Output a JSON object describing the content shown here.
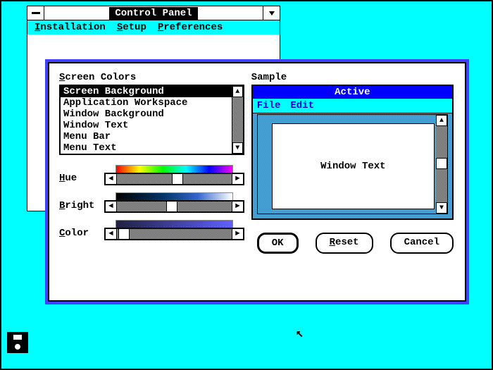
{
  "cp": {
    "title": "Control Panel",
    "menus": {
      "installation": "Installation",
      "setup": "Setup",
      "preferences": "Preferences"
    }
  },
  "dlg": {
    "section_left": "Screen Colors",
    "section_right": "Sample",
    "list": [
      "Screen Background",
      "Application Workspace",
      "Window Background",
      "Window Text",
      "Menu Bar",
      "Menu Text"
    ],
    "sliders": {
      "hue": "Hue",
      "bright": "Bright",
      "color": "Color"
    },
    "sample": {
      "title": "Active",
      "menu_file": "File",
      "menu_edit": "Edit",
      "window_text": "Window Text"
    },
    "buttons": {
      "ok": "OK",
      "reset": "Reset",
      "cancel": "Cancel"
    }
  },
  "colors": {
    "desktop": "#00ffff",
    "accent": "#4040ff",
    "titlebar_active": "#0000ff"
  }
}
